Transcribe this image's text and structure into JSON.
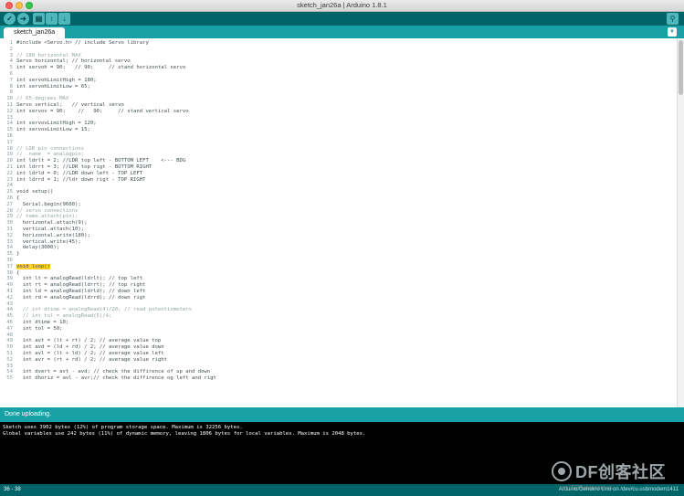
{
  "window": {
    "title": "sketch_jan26a | Arduino 1.8.1"
  },
  "toolbar": {
    "verify_icon": "check-icon",
    "upload_icon": "arrow-right-icon",
    "new_icon": "new-file-icon",
    "open_icon": "arrow-up-icon",
    "save_icon": "arrow-down-icon",
    "serial_icon": "magnifier-icon"
  },
  "tabs": [
    {
      "label": "sketch_jan26a"
    }
  ],
  "editor": {
    "lines": [
      {
        "n": "1",
        "text": "#include <Servo.h> // include Servo library"
      },
      {
        "n": "2",
        "text": ""
      },
      {
        "n": "3",
        "text": "// 180 horizontal MAX"
      },
      {
        "n": "4",
        "text": "Servo horizontal; // horizontal servo"
      },
      {
        "n": "5",
        "text": "int servoh = 90;   // 90;     // stand horizontal servo"
      },
      {
        "n": "6",
        "text": ""
      },
      {
        "n": "7",
        "text": "int servohLimitHigh = 180;"
      },
      {
        "n": "8",
        "text": "int servohLimitLow = 65;"
      },
      {
        "n": "9",
        "text": ""
      },
      {
        "n": "10",
        "text": "// 65 degrees MAX"
      },
      {
        "n": "11",
        "text": "Servo vertical;   // vertical servo"
      },
      {
        "n": "12",
        "text": "int servov = 90;    //   90;     // stand vertical servo"
      },
      {
        "n": "13",
        "text": ""
      },
      {
        "n": "14",
        "text": "int servovLimitHigh = 120;"
      },
      {
        "n": "15",
        "text": "int servovLimitLow = 15;"
      },
      {
        "n": "16",
        "text": ""
      },
      {
        "n": "17",
        "text": ""
      },
      {
        "n": "18",
        "text": "// LDR pin connections"
      },
      {
        "n": "19",
        "text": "//  name  = analogpin;"
      },
      {
        "n": "20",
        "text": "int ldrlt = 2; //LDR top left - BOTTOM LEFT    <--- BDG"
      },
      {
        "n": "21",
        "text": "int ldrrt = 3; //LDR top rigt - BOTTOM RIGHT"
      },
      {
        "n": "22",
        "text": "int ldrld = 0; //LDR down left - TOP LEFT"
      },
      {
        "n": "23",
        "text": "int ldrrd = 1; //ldr down rigt - TOP RIGHT"
      },
      {
        "n": "24",
        "text": ""
      },
      {
        "n": "25",
        "text": "void setup()"
      },
      {
        "n": "26",
        "text": "{"
      },
      {
        "n": "27",
        "text": "  Serial.begin(9600);"
      },
      {
        "n": "28",
        "text": "// servo connections"
      },
      {
        "n": "29",
        "text": "// name.attach(pin);"
      },
      {
        "n": "30",
        "text": "  horizontal.attach(9);"
      },
      {
        "n": "31",
        "text": "  vertical.attach(10);"
      },
      {
        "n": "32",
        "text": "  horizontal.write(180);"
      },
      {
        "n": "33",
        "text": "  vertical.write(45);"
      },
      {
        "n": "34",
        "text": "  delay(3000);"
      },
      {
        "n": "35",
        "text": "}"
      },
      {
        "n": "36",
        "text": ""
      },
      {
        "n": "37",
        "text": "void loop()"
      },
      {
        "n": "38",
        "text": "{"
      },
      {
        "n": "39",
        "text": "  int lt = analogRead(ldrlt); // top left"
      },
      {
        "n": "40",
        "text": "  int rt = analogRead(ldrrt); // top right"
      },
      {
        "n": "41",
        "text": "  int ld = analogRead(ldrld); // down left"
      },
      {
        "n": "42",
        "text": "  int rd = analogRead(ldrrd); // down rigt"
      },
      {
        "n": "43",
        "text": ""
      },
      {
        "n": "44",
        "text": "  // int dtime = analogRead(4)/20; // read potentiometers"
      },
      {
        "n": "45",
        "text": "  // int tol = analogRead(5)/4;"
      },
      {
        "n": "46",
        "text": "  int dtime = 10;"
      },
      {
        "n": "47",
        "text": "  int tol = 50;"
      },
      {
        "n": "48",
        "text": ""
      },
      {
        "n": "49",
        "text": "  int avt = (lt + rt) / 2; // average value top"
      },
      {
        "n": "50",
        "text": "  int avd = (ld + rd) / 2; // average value down"
      },
      {
        "n": "51",
        "text": "  int avl = (lt + ld) / 2; // average value left"
      },
      {
        "n": "52",
        "text": "  int avr = (rt + rd) / 2; // average value right"
      },
      {
        "n": "53",
        "text": ""
      },
      {
        "n": "54",
        "text": "  int dvert = avt - avd; // check the diffirence of up and down"
      },
      {
        "n": "55",
        "text": "  int dhoriz = avl - avr;// check the diffirence og left and rigt"
      }
    ]
  },
  "status": {
    "message": "Done uploading."
  },
  "console": {
    "lines": [
      "Sketch uses 3902 bytes (12%) of program storage space. Maximum is 32256 bytes.",
      "Global variables use 242 bytes (11%) of dynamic memory, leaving 1806 bytes for local variables. Maximum is 2048 bytes."
    ]
  },
  "footer": {
    "cursor": "36 - 38",
    "board": "Arduino/Genuino Uno on /dev/cu.usbmodem1411"
  },
  "watermark": {
    "brand": "DF创客社区",
    "url": "mc.DFRobot.com.cn"
  },
  "colors": {
    "toolbar": "#006468",
    "tabbar": "#17a1a5",
    "highlight": "#ffd12a",
    "console_bg": "#000000"
  }
}
